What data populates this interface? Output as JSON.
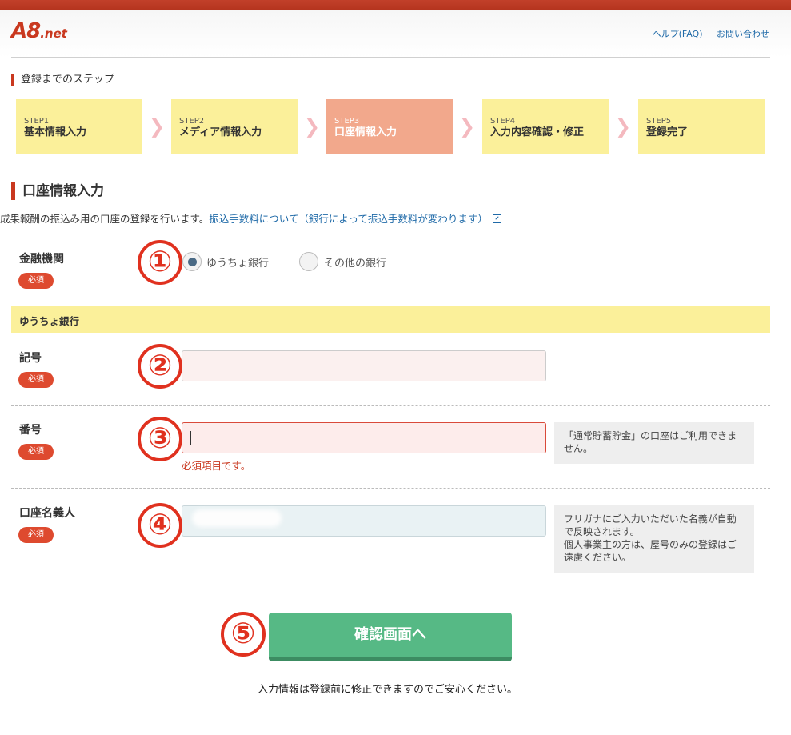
{
  "header": {
    "logo": "A8",
    "logo_suffix": ".net",
    "links": [
      "ヘルプ(FAQ)",
      "お問い合わせ"
    ]
  },
  "steps": {
    "title": "登録までのステップ",
    "items": [
      {
        "num": "STEP1",
        "label": "基本情報入力",
        "active": false
      },
      {
        "num": "STEP2",
        "label": "メディア情報入力",
        "active": false
      },
      {
        "num": "STEP3",
        "label": "口座情報入力",
        "active": true
      },
      {
        "num": "STEP4",
        "label": "入力内容確認・修正",
        "active": false
      },
      {
        "num": "STEP5",
        "label": "登録完了",
        "active": false
      }
    ]
  },
  "section": {
    "title": "口座情報入力",
    "description": "成果報酬の振込み用の口座の登録を行います。",
    "fee_link": "振込手数料について（銀行によって振込手数料が変わります）"
  },
  "required_badge": "必須",
  "callouts": [
    "①",
    "②",
    "③",
    "④",
    "⑤"
  ],
  "bank": {
    "label": "金融機関",
    "options": [
      {
        "label": "ゆうちょ銀行",
        "checked": true
      },
      {
        "label": "その他の銀行",
        "checked": false
      }
    ]
  },
  "yucho_band": "ゆうちょ銀行",
  "fields": {
    "kigo": {
      "label": "記号",
      "value": ""
    },
    "bango": {
      "label": "番号",
      "value": "",
      "error": "必須項目です。",
      "note": "「通常貯蓄貯金」の口座はご利用できません。"
    },
    "meigi": {
      "label": "口座名義人",
      "note_lines": [
        "フリガナにご入力いただいた名義が自動で反映されます。",
        "個人事業主の方は、屋号のみの登録はご遠慮ください。"
      ]
    }
  },
  "submit_label": "確認画面へ",
  "footnote": "入力情報は登録前に修正できますのでご安心ください。"
}
